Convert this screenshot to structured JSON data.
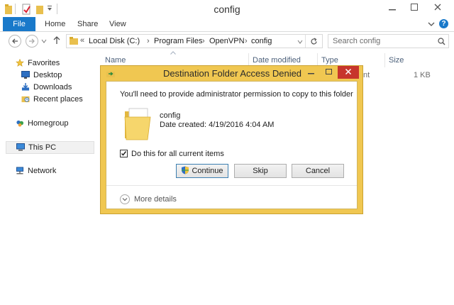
{
  "window": {
    "title": "config"
  },
  "ribbon": {
    "tabs": [
      "File",
      "Home",
      "Share",
      "View"
    ]
  },
  "address": {
    "overflow": "«",
    "crumbs": [
      "Local Disk (C:)",
      "Program Files",
      "OpenVPN",
      "config"
    ],
    "search_placeholder": "Search config"
  },
  "nav": {
    "favorites": "Favorites",
    "desktop": "Desktop",
    "downloads": "Downloads",
    "recent": "Recent places",
    "homegroup": "Homegroup",
    "thispc": "This PC",
    "network": "Network"
  },
  "columns": {
    "name": "Name",
    "date": "Date modified",
    "type": "Type",
    "size": "Size"
  },
  "file_row": {
    "type_fragment": "nt",
    "size": "1 KB"
  },
  "dialog": {
    "title": "Destination Folder Access Denied",
    "message": "You'll need to provide administrator permission to copy to this folder",
    "folder_name": "config",
    "date_created": "Date created: 4/19/2016 4:04 AM",
    "checkbox_label": "Do this for all current items",
    "checkbox_checked": true,
    "continue": "Continue",
    "skip": "Skip",
    "cancel": "Cancel",
    "more_details": "More details"
  },
  "colors": {
    "accent": "#1979ca",
    "dialog_frame": "#f0c751",
    "close_red": "#c7352c",
    "folder": "#f6d66c"
  }
}
